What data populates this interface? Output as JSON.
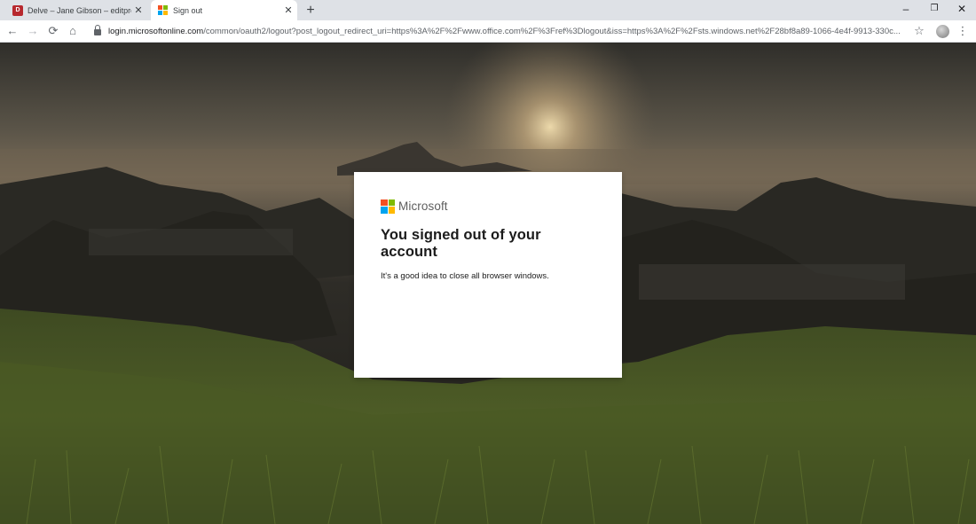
{
  "browser": {
    "tabs": [
      {
        "label": "Delve – Jane Gibson – editprofile",
        "favicon": "delve-icon"
      },
      {
        "label": "Sign out",
        "favicon": "microsoft-icon"
      }
    ],
    "new_tab_glyph": "+",
    "tab_close_glyph": "✕",
    "window_controls": {
      "minimize": "–",
      "restore": "❐",
      "close": "✕"
    },
    "nav": {
      "back": "←",
      "forward": "→",
      "reload": "⟳",
      "home": "⌂"
    },
    "address": {
      "host": "login.microsoftonline.com",
      "path": "/common/oauth2/logout?post_logout_redirect_uri=https%3A%2F%2Fwww.office.com%2F%3Fref%3Dlogout&iss=https%3A%2F%2Fsts.windows.net%2F28bf8a89-1066-4e4f-9913-330c..."
    },
    "bookmark_glyph": "☆",
    "menu_glyph": "⋮"
  },
  "card": {
    "brand": "Microsoft",
    "heading": "You signed out of your account",
    "message": "It's a good idea to close all browser windows."
  },
  "colors": {
    "ms_red": "#f25022",
    "ms_green": "#7fba00",
    "ms_blue": "#00a4ef",
    "ms_yellow": "#ffb900",
    "tabstrip": "#dee1e6"
  }
}
